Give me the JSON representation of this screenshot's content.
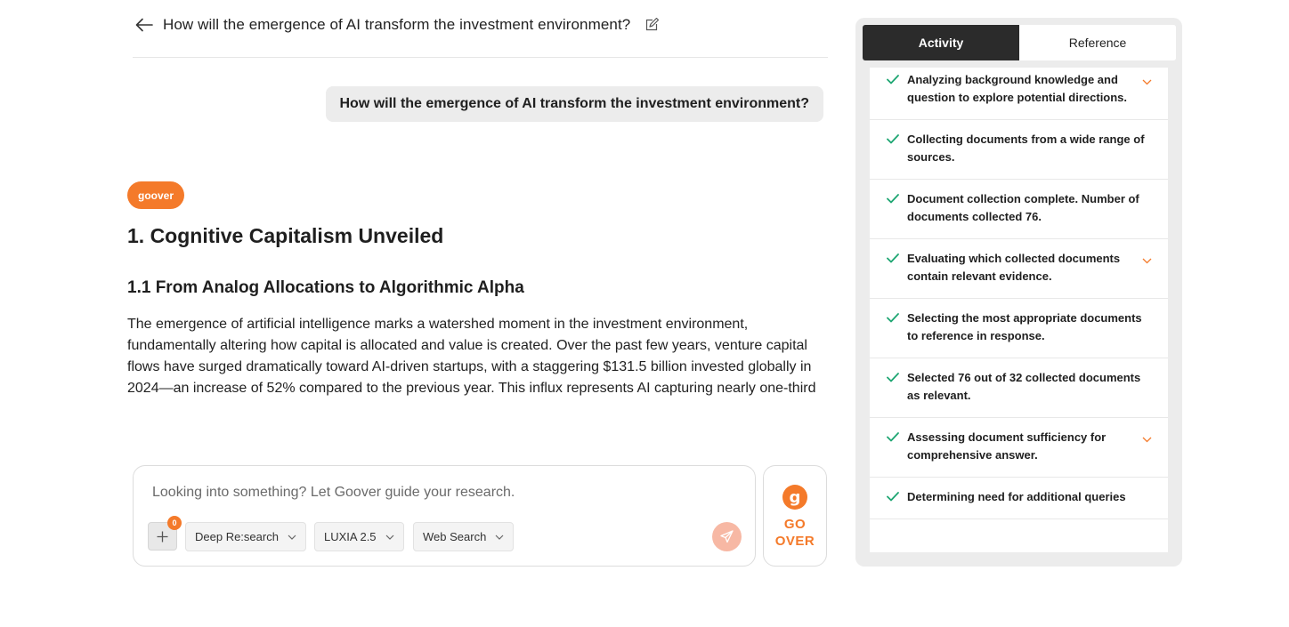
{
  "header": {
    "title": "How will the emergence of AI transform the investment environment?"
  },
  "user_message": "How will the emergence of AI transform the investment environment?",
  "answer": {
    "brand": "goover",
    "heading1": "1. Cognitive Capitalism Unveiled",
    "heading2": "1.1 From Analog Allocations to Algorithmic Alpha",
    "paragraph": "The emergence of artificial intelligence marks a watershed moment in the investment environment, fundamentally altering how capital is allocated and value is created. Over the past few years, venture capital flows have surged dramatically toward AI-driven startups, with a staggering $131.5 billion invested globally in 2024—an increase of 52% compared to the previous year. This influx represents AI capturing nearly one-third"
  },
  "composer": {
    "placeholder": "Looking into something? Let Goover guide your research.",
    "attach_count": "0",
    "mode_select": "Deep Re:search",
    "model_select": "LUXIA 2.5",
    "source_select": "Web Search"
  },
  "goover_button": {
    "logo_letter": "g",
    "line1": "GO",
    "line2": "OVER"
  },
  "panel": {
    "tabs": [
      {
        "label": "Activity",
        "active": true
      },
      {
        "label": "Reference",
        "active": false
      }
    ],
    "activities": [
      {
        "text": "Analyzing background knowledge and question to explore potential directions.",
        "expandable": true
      },
      {
        "text": "Collecting documents from a wide range of sources.",
        "expandable": false
      },
      {
        "text": "Document collection complete. Number of documents collected 76.",
        "expandable": false
      },
      {
        "text": "Evaluating which collected documents contain relevant evidence.",
        "expandable": true
      },
      {
        "text": "Selecting the most appropriate documents to reference in response.",
        "expandable": false
      },
      {
        "text": "Selected 76 out of 32 collected documents as relevant.",
        "expandable": false
      },
      {
        "text": "Assessing document sufficiency for comprehensive answer.",
        "expandable": true
      },
      {
        "text": "Determining need for additional queries",
        "expandable": false
      }
    ]
  },
  "colors": {
    "accent": "#f47a2a",
    "check": "#1ea672",
    "tab_active_bg": "#2b2b2b"
  }
}
